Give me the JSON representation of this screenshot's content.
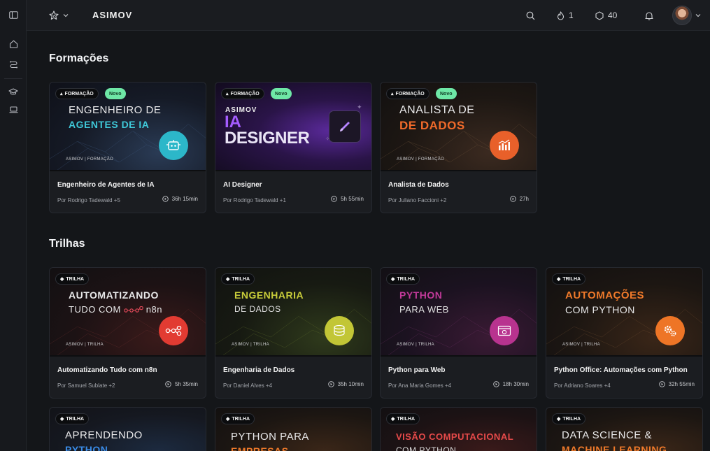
{
  "topbar": {
    "brand": "ASIMOV",
    "streak_count": "1",
    "points_count": "40"
  },
  "sections": {
    "formacoes_title": "Formações",
    "trilhas_title": "Trilhas"
  },
  "badges": {
    "formacao": "FORMAÇÃO",
    "trilha": "TRILHA",
    "novo": "Novo"
  },
  "formacoes": [
    {
      "thumb_line1": "ENGENHEIRO DE",
      "thumb_line2": "AGENTES DE IA",
      "thumb_footer": "ASIMOV | FORMAÇÃO",
      "title": "Engenheiro de Agentes de IA",
      "author": "Por Rodrigo Tadewald +5",
      "duration": "36h 15min",
      "accent": "#3fc9d9"
    },
    {
      "thumb_brand": "ASIMOV",
      "thumb_line1": "IA",
      "thumb_line2": "DESIGNER",
      "title": "AI Designer",
      "author": "Por Rodrigo Tadewald +1",
      "duration": "5h 55min",
      "accent": "#9b4dff"
    },
    {
      "thumb_line1": "ANALISTA DE",
      "thumb_line2": "DE DADOS",
      "thumb_footer": "ASIMOV | FORMAÇÃO",
      "title": "Analista de Dados",
      "author": "Por Juliano Faccioni +2",
      "duration": "27h",
      "accent": "#f06a2a"
    }
  ],
  "trilhas": [
    {
      "thumb_line1": "AUTOMATIZANDO",
      "thumb_line2": "TUDO COM",
      "thumb_line2_suffix": "n8n",
      "thumb_footer": "ASIMOV | TRILHA",
      "title": "Automatizando Tudo com n8n",
      "author": "Por Samuel Sublate +2",
      "duration": "5h 35min",
      "accent": "#e63e3e"
    },
    {
      "thumb_line1": "ENGENHARIA",
      "thumb_line2": "DE DADOS",
      "thumb_footer": "ASIMOV | TRILHA",
      "title": "Engenharia de Dados",
      "author": "Por Daniel Alves +4",
      "duration": "35h 10min",
      "accent": "#c9cd3a"
    },
    {
      "thumb_line1": "PYTHON",
      "thumb_line2": "PARA WEB",
      "thumb_footer": "ASIMOV | TRILHA",
      "title": "Python para Web",
      "author": "Por Ana Maria Gomes +4",
      "duration": "18h 30min",
      "accent": "#c23a9a"
    },
    {
      "thumb_line1": "AUTOMAÇÕES",
      "thumb_line2": "COM PYTHON",
      "thumb_footer": "ASIMOV | TRILHA",
      "title": "Python Office: Automações com Python",
      "author": "Por Adriano Soares +4",
      "duration": "32h 55min",
      "accent": "#f07a2a"
    }
  ],
  "trilhas_row2": [
    {
      "thumb_line1": "APRENDENDO",
      "thumb_line2": "PYTHON",
      "accent": "#3a8be6"
    },
    {
      "thumb_line1": "PYTHON PARA",
      "thumb_line2": "EMPRESAS",
      "accent": "#f07a2a"
    },
    {
      "thumb_line1": "VISÃO COMPUTACIONAL",
      "thumb_line2": "COM PYTHON",
      "accent": "#e64a4a"
    },
    {
      "thumb_line1": "DATA SCIENCE &",
      "thumb_line2": "MACHINE LEARNING",
      "accent": "#f07a2a"
    }
  ]
}
